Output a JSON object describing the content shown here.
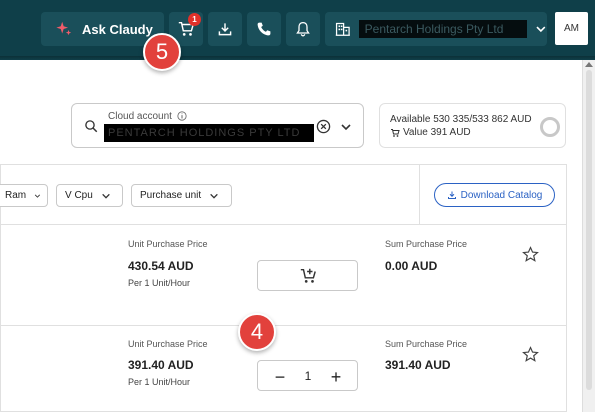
{
  "header": {
    "ask_label": "Ask Claudy",
    "cart_badge": "1",
    "company_name": "Pentarch Holdings Pty Ltd",
    "avatar_initials": "AM"
  },
  "steps": {
    "step_5": "5",
    "step_4": "4"
  },
  "cloud_account": {
    "label": "Cloud account",
    "value": "PENTARCH HOLDINGS PTY LTD"
  },
  "balance": {
    "available_label": "Available",
    "available_value": "530 335/533 862 AUD",
    "value_label": "Value",
    "value_amount": "391 AUD"
  },
  "filters": {
    "ram": "Ram",
    "vcpu": "V Cpu",
    "purchase_unit": "Purchase unit"
  },
  "catalog": {
    "download_label": "Download Catalog"
  },
  "rows": [
    {
      "unit_label": "Unit Purchase Price",
      "unit_price": "430.54 AUD",
      "per_unit": "Per 1 Unit/Hour",
      "sum_label": "Sum Purchase Price",
      "sum_price": "0.00 AUD"
    },
    {
      "unit_label": "Unit Purchase Price",
      "unit_price": "391.40 AUD",
      "per_unit": "Per 1 Unit/Hour",
      "sum_label": "Sum Purchase Price",
      "sum_price": "391.40 AUD",
      "quantity": "1"
    }
  ],
  "colors": {
    "header_bg": "#0f3f49",
    "accent_blue": "#2b62c4",
    "step_red": "#e2413c",
    "badge_red": "#e0312a"
  },
  "icons": [
    "sparkle-icon",
    "cart-icon",
    "download-icon",
    "phone-icon",
    "bell-icon",
    "building-icon",
    "chevron-down-icon",
    "search-icon",
    "info-icon",
    "clear-icon",
    "star-icon",
    "add-to-cart-icon",
    "wallet-icon"
  ]
}
